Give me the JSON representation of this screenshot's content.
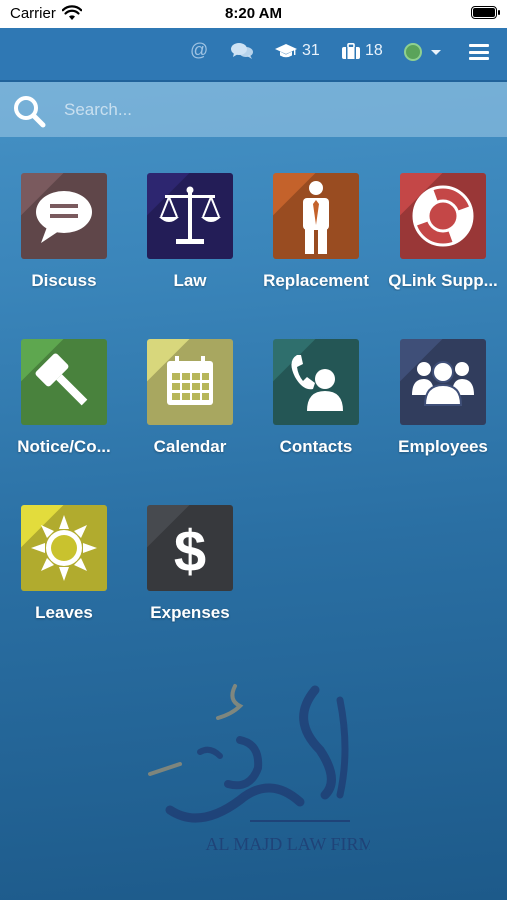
{
  "status_bar": {
    "carrier": "Carrier",
    "time": "8:20 AM"
  },
  "top_bar": {
    "mentions_icon": "at-icon",
    "messages_icon": "chat-icon",
    "courses_count": "31",
    "jobs_count": "18",
    "menu_icon": "hamburger-icon"
  },
  "search": {
    "placeholder": "Search..."
  },
  "apps": [
    {
      "label": "Discuss",
      "color": "#7a5a5e",
      "icon": "chat-bubble-icon"
    },
    {
      "label": "Law",
      "color": "#2d2670",
      "icon": "scales-icon"
    },
    {
      "label": "Replacement",
      "color": "#c4622b",
      "icon": "person-tie-icon"
    },
    {
      "label": "QLink Supp...",
      "color": "#c44747",
      "icon": "lifebuoy-icon"
    },
    {
      "label": "Notice/Co...",
      "color": "#5ea74f",
      "icon": "gavel-icon"
    },
    {
      "label": "Calendar",
      "color": "#d8d77c",
      "icon": "calendar-icon"
    },
    {
      "label": "Contacts",
      "color": "#2f6f6d",
      "icon": "phone-contact-icon"
    },
    {
      "label": "Employees",
      "color": "#3f4f78",
      "icon": "group-icon"
    },
    {
      "label": "Leaves",
      "color": "#e3dc3c",
      "icon": "sun-icon"
    },
    {
      "label": "Expenses",
      "color": "#474a4f",
      "icon": "dollar-icon"
    }
  ],
  "logo": {
    "latin_text": "AL MAJD LAW FIRM"
  }
}
